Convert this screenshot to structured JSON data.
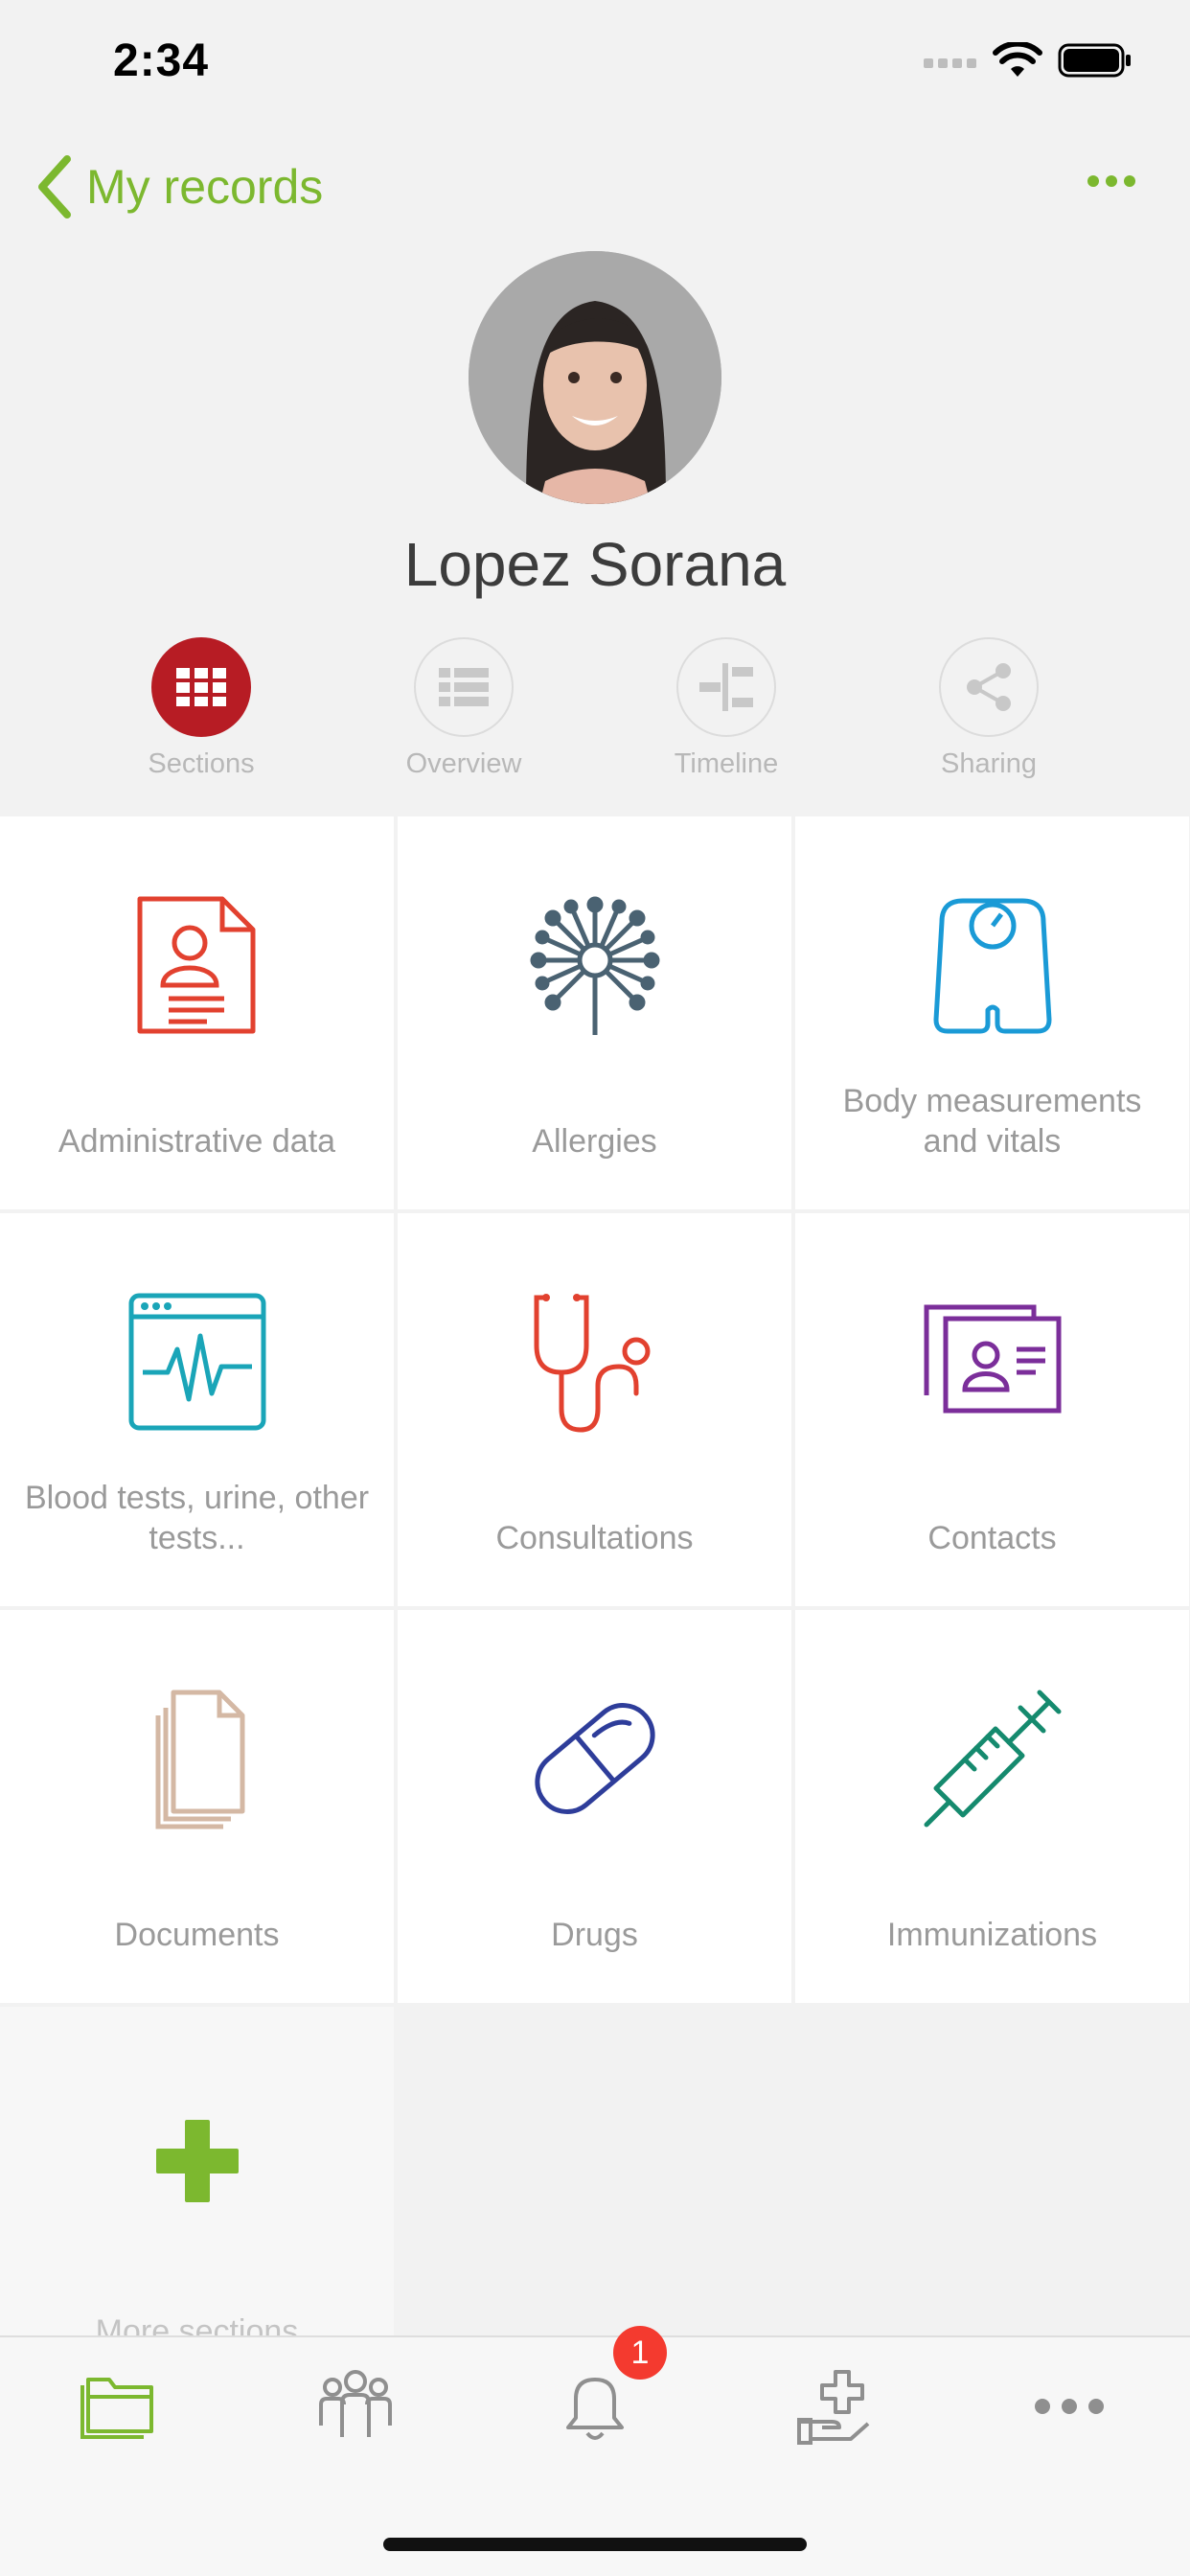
{
  "status": {
    "time": "2:34"
  },
  "nav": {
    "back_label": "My records"
  },
  "profile": {
    "name": "Lopez Sorana"
  },
  "tabs": [
    {
      "label": "Sections",
      "active": true
    },
    {
      "label": "Overview",
      "active": false
    },
    {
      "label": "Timeline",
      "active": false
    },
    {
      "label": "Sharing",
      "active": false
    }
  ],
  "sections": [
    {
      "label": "Administrative data",
      "icon": "administrative-data-icon",
      "color": "#e2412f"
    },
    {
      "label": "Allergies",
      "icon": "allergies-icon",
      "color": "#4a6272"
    },
    {
      "label": "Body measurements and vitals",
      "icon": "body-scale-icon",
      "color": "#1a9ad6"
    },
    {
      "label": "Blood tests, urine, other tests...",
      "icon": "lab-tests-icon",
      "color": "#1aa5b8"
    },
    {
      "label": "Consultations",
      "icon": "stethoscope-icon",
      "color": "#e2412f"
    },
    {
      "label": "Contacts",
      "icon": "contacts-icon",
      "color": "#7b2e9a"
    },
    {
      "label": "Documents",
      "icon": "documents-icon",
      "color": "#d4b8a4"
    },
    {
      "label": "Drugs",
      "icon": "pill-icon",
      "color": "#2e3d9a"
    },
    {
      "label": "Immunizations",
      "icon": "syringe-icon",
      "color": "#158a6e"
    },
    {
      "label": "More sections",
      "icon": "plus-icon",
      "color": "#7cb82f"
    }
  ],
  "tabbar": {
    "items": [
      {
        "icon": "folders-icon",
        "active": true
      },
      {
        "icon": "people-icon",
        "active": false
      },
      {
        "icon": "bell-icon",
        "active": false
      },
      {
        "icon": "medical-hand-icon",
        "active": false
      },
      {
        "icon": "more-icon",
        "active": false
      }
    ],
    "notification_badge": "1"
  },
  "colors": {
    "accent": "#7cb82f",
    "active_tab": "#b71c24",
    "badge": "#f43a2f"
  }
}
